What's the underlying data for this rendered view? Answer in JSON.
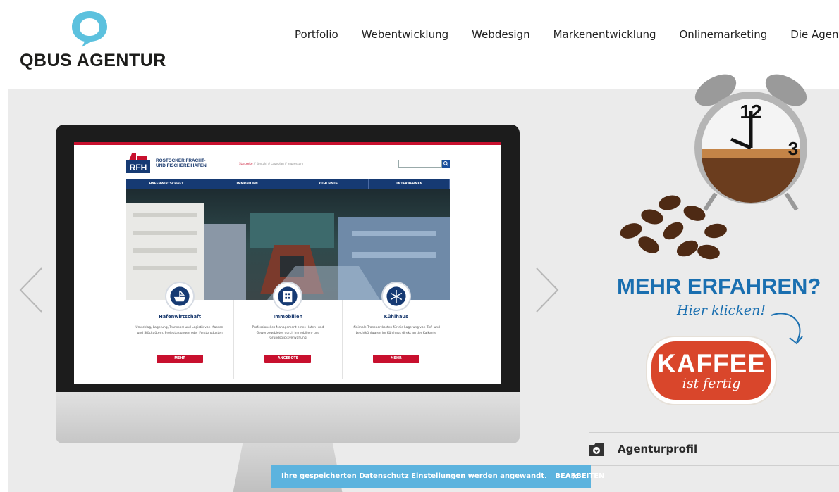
{
  "header": {
    "logo_text": "QBUS AGENTUR",
    "nav": [
      "Portfolio",
      "Webentwicklung",
      "Webdesign",
      "Markenentwicklung",
      "Onlinemarketing",
      "Die Agentur"
    ]
  },
  "rfh_site": {
    "logo_letters": "RFH",
    "name_line1": "ROSTOCKER FRACHT-",
    "name_line2": "UND FISCHEREIHAFEN",
    "top_links": [
      "Startseite",
      "Kontakt",
      "Lageplan",
      "Impressum"
    ],
    "menu": [
      "HAFENWIRTSCHAFT",
      "IMMOBILIEN",
      "KÜHLHAUS",
      "UNTERNEHMEN"
    ],
    "cards": [
      {
        "title": "Hafenwirtschaft",
        "text": "Umschlag, Lagerung, Transport und Logistik von Massen- und Stückgütern, Projektladungen oder Forstprodukten",
        "button": "MEHR"
      },
      {
        "title": "Immobilien",
        "text": "Professionelles Management eines Hafen- und Gewerbegebietes durch Immobilien- und Grundstücksverwaltung",
        "button": "ANGEBOTE"
      },
      {
        "title": "Kühlhaus",
        "text": "Minimale Transportkosten für die Lagerung von Tief- und Leichtkühlwaren im Kühlhaus direkt an der Kaikante",
        "button": "MEHR"
      }
    ]
  },
  "promo": {
    "headline": "MEHR ERFAHREN?",
    "subline": "Hier klicken!",
    "badge_title": "KAFFEE",
    "badge_sub": "ist fertig",
    "clock_numbers": [
      "12",
      "3"
    ]
  },
  "profile": {
    "label": "Agenturprofil"
  },
  "cookie": {
    "text": "Ihre gespeicherten Datenschutz Einstellungen werden angewandt.",
    "edit": "BEARBEITEN",
    "close": "×"
  },
  "colors": {
    "brand_blue": "#1a6fb0",
    "logo_cyan": "#5cc1de",
    "rfh_navy": "#163a73",
    "rfh_red": "#c8102e",
    "kaffee_red": "#d9462b",
    "cookie_bar": "#5cb3de"
  }
}
